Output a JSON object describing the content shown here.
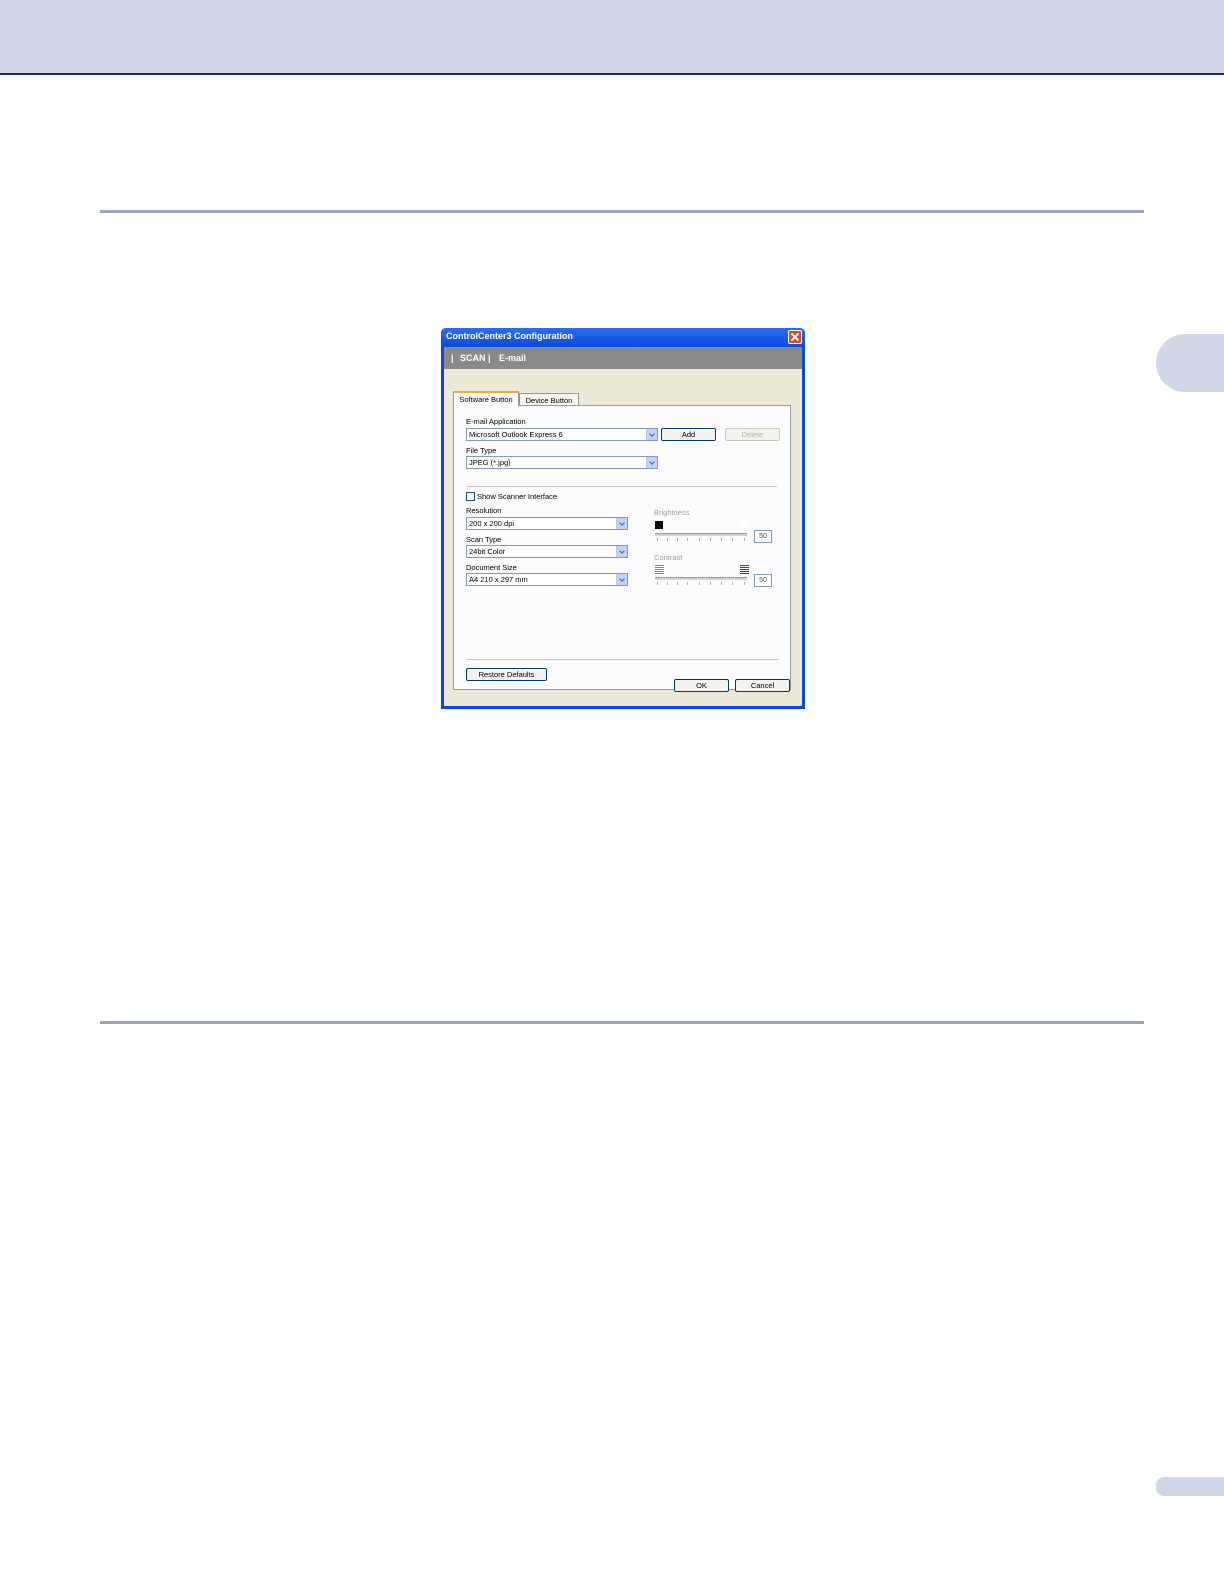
{
  "dialog": {
    "title": "ControlCenter3 Configuration",
    "breadcrumb": {
      "sep": "|",
      "section": "SCAN",
      "page": "E-mail"
    },
    "tabs": [
      {
        "label": "Software Button",
        "active": true
      },
      {
        "label": "Device Button",
        "active": false
      }
    ],
    "email_application": {
      "label": "E-mail Application",
      "value": "Microsoft Outlook Express 6",
      "add_label": "Add",
      "delete_label": "Delete"
    },
    "file_type": {
      "label": "File Type",
      "value": "JPEG (*.jpg)"
    },
    "show_scanner_interface": {
      "label": "Show Scanner Interface",
      "checked": false
    },
    "resolution": {
      "label": "Resolution",
      "value": "200 x 200 dpi"
    },
    "scan_type": {
      "label": "Scan Type",
      "value": "24bit Color"
    },
    "document_size": {
      "label": "Document Size",
      "value": "A4 210 x 297 mm"
    },
    "brightness": {
      "label": "Brightness",
      "value": "50"
    },
    "contrast": {
      "label": "Contrast",
      "value": "50"
    },
    "restore_defaults_label": "Restore Defaults",
    "ok_label": "OK",
    "cancel_label": "Cancel"
  },
  "colors": {
    "title_bar": "#0a4cd8",
    "header_band": "#d1d7e8",
    "rule": "#9aa2c6",
    "breadcrumb_bar": "#8a8a8a",
    "dialog_face": "#ece9d8"
  }
}
